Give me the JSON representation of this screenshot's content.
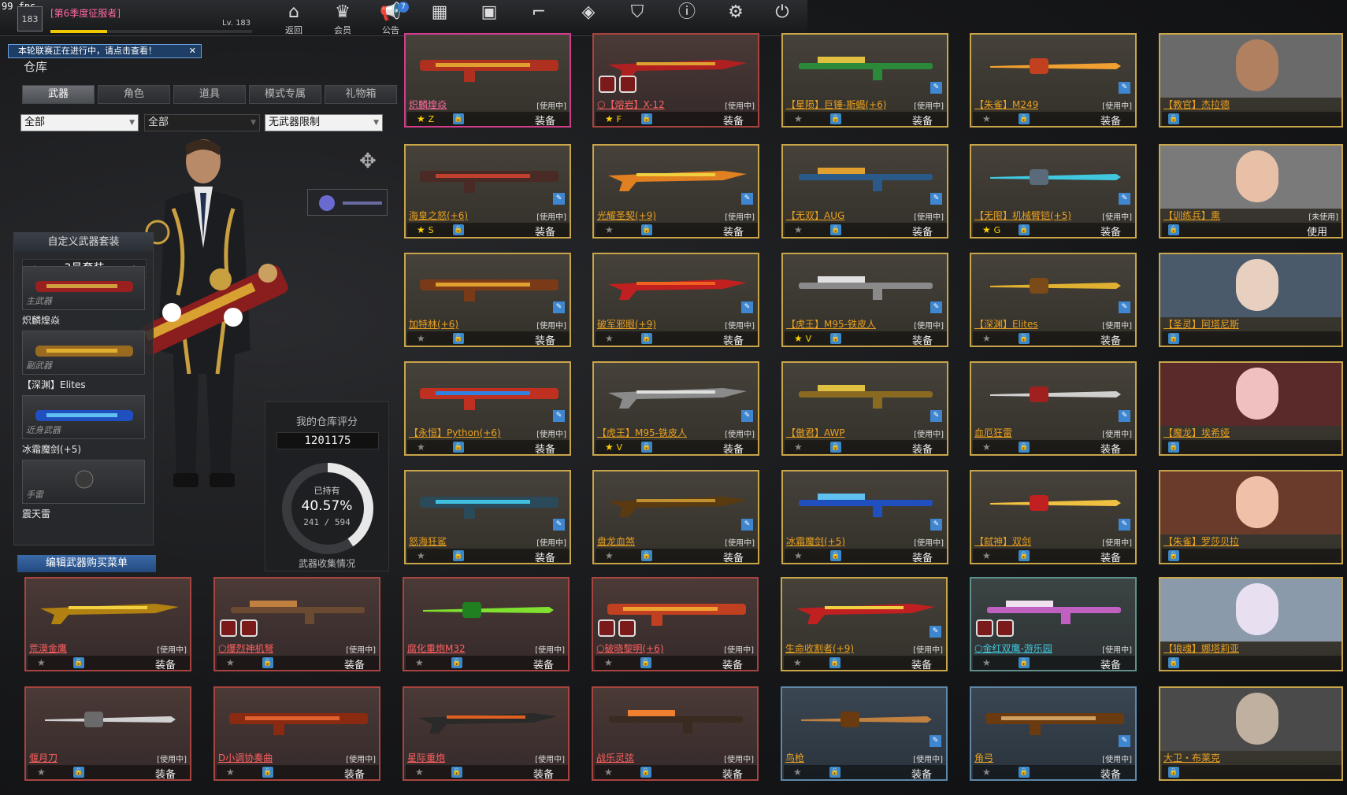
{
  "fps": "99 fps",
  "player": {
    "level_badge": "183",
    "season_title": "[第6季度征服者]",
    "level": "Lv. 183",
    "xp": 0.28
  },
  "nav": [
    {
      "label": "返回",
      "icon": "home-icon"
    },
    {
      "label": "会员",
      "icon": "crown-icon"
    },
    {
      "label": "公告",
      "icon": "megaphone-icon",
      "badge": "7"
    },
    {
      "label": "",
      "icon": "calendar-icon"
    },
    {
      "label": "",
      "icon": "briefcase-icon"
    },
    {
      "label": "",
      "icon": "boot-icon"
    },
    {
      "label": "",
      "icon": "ticket-icon"
    },
    {
      "label": "",
      "icon": "shield-f-icon"
    },
    {
      "label": "",
      "icon": "alert-icon"
    },
    {
      "label": "",
      "icon": "gear-icon"
    },
    {
      "label": "",
      "icon": "power-icon"
    }
  ],
  "notice": "本轮联赛正在进行中，请点击查看！",
  "warehouse_title": "仓库",
  "tabs": [
    "武器",
    "角色",
    "道具",
    "模式专属",
    "礼物箱"
  ],
  "filters": [
    "全部",
    "全部",
    "无武器限制"
  ],
  "loadout": {
    "header": "自定义武器套装",
    "set": "3号套装",
    "slots": [
      {
        "type": "主武器",
        "name": "炽麟煌焱",
        "color": "#e8e8e8"
      },
      {
        "type": "副武器",
        "name": "【深渊】Elites",
        "color": "#e8e8e8"
      },
      {
        "type": "近身武器",
        "name": "冰霜魔剑(+5)",
        "color": "#e8e8e8"
      },
      {
        "type": "手雷",
        "name": "震天雷",
        "color": "#e8e8e8"
      }
    ],
    "edit_buy": "编辑武器购买菜单"
  },
  "rating": {
    "title": "我的仓库评分",
    "score": "1201175",
    "owned_label": "已持有",
    "percent": "40.57%",
    "count": "241 / 594",
    "caption": "武器收集情况",
    "fraction": 0.4057
  },
  "status_in_use": "[使用中]",
  "status_unused": "[未使用]",
  "equip": "装备",
  "use": "使用",
  "weapons": [
    {
      "name": "炽麟煌焱",
      "grade": "Z",
      "style": "pink",
      "namecolor": "pink",
      "col": 0,
      "row": 0,
      "c1": "#b03020",
      "c2": "#e0a030"
    },
    {
      "name": "⬡【熔岩】X-12",
      "grade": "F",
      "style": "red",
      "namecolor": "red",
      "col": 1,
      "row": 0,
      "c1": "#b02020",
      "c2": "#e0a030",
      "mods": true
    },
    {
      "name": "【星陨】巨锤-斯蝎(+6)",
      "grade": "",
      "style": "gold",
      "namecolor": "",
      "col": 2,
      "row": 0,
      "c1": "#2a8a3a",
      "c2": "#e0c040"
    },
    {
      "name": "【朱雀】M249",
      "grade": "",
      "style": "gold",
      "namecolor": "",
      "col": 3,
      "row": 0,
      "c1": "#c04020",
      "c2": "#f0a030"
    },
    {
      "name": "海皇之怒(+6)",
      "grade": "S",
      "style": "gold",
      "namecolor": "",
      "col": 0,
      "row": 1,
      "c1": "#4a2a24",
      "c2": "#c04030"
    },
    {
      "name": "光耀圣契(+9)",
      "grade": "",
      "style": "gold",
      "namecolor": "",
      "col": 1,
      "row": 1,
      "c1": "#e08020",
      "c2": "#f0d040"
    },
    {
      "name": "【无双】AUG",
      "grade": "",
      "style": "gold",
      "namecolor": "",
      "col": 2,
      "row": 1,
      "c1": "#2a5a8a",
      "c2": "#e0a030"
    },
    {
      "name": "【无限】机械臂铠(+5)",
      "grade": "G",
      "style": "gold",
      "namecolor": "",
      "col": 3,
      "row": 1,
      "c1": "#5a6a7a",
      "c2": "#40c8e0"
    },
    {
      "name": "加特林(+6)",
      "grade": "",
      "style": "gold",
      "namecolor": "",
      "col": 0,
      "row": 2,
      "c1": "#7a3a18",
      "c2": "#e0a030"
    },
    {
      "name": "破军邪眼(+9)",
      "grade": "",
      "style": "gold",
      "namecolor": "",
      "col": 1,
      "row": 2,
      "c1": "#c02020",
      "c2": "#f06020"
    },
    {
      "name": "【虎王】M95-铁皮人",
      "grade": "V",
      "style": "gold",
      "namecolor": "",
      "col": 2,
      "row": 2,
      "c1": "#8a8a8a",
      "c2": "#e0e0e0"
    },
    {
      "name": "【深渊】Elites",
      "grade": "",
      "style": "gold",
      "namecolor": "",
      "col": 3,
      "row": 2,
      "c1": "#7a4a18",
      "c2": "#e0b030"
    },
    {
      "name": "【永恒】Python(+6)",
      "grade": "",
      "style": "gold",
      "namecolor": "",
      "col": 0,
      "row": 3,
      "c1": "#c03020",
      "c2": "#3080e0"
    },
    {
      "name": "【虎王】M95-铁皮人",
      "grade": "V",
      "style": "gold",
      "namecolor": "",
      "col": 1,
      "row": 3,
      "c1": "#8a8a8a",
      "c2": "#e0e0e0"
    },
    {
      "name": "【傲君】AWP",
      "grade": "",
      "style": "gold",
      "namecolor": "",
      "col": 2,
      "row": 3,
      "c1": "#8a6a20",
      "c2": "#e0c040"
    },
    {
      "name": "血厄狂雷",
      "grade": "",
      "style": "gold",
      "namecolor": "",
      "col": 3,
      "row": 3,
      "c1": "#a02020",
      "c2": "#d0d0d0"
    },
    {
      "name": "怒海狂鲨",
      "grade": "",
      "style": "gold",
      "namecolor": "",
      "col": 0,
      "row": 4,
      "c1": "#2a4a5a",
      "c2": "#40c0e0"
    },
    {
      "name": "盘龙血煞",
      "grade": "",
      "style": "gold",
      "namecolor": "",
      "col": 1,
      "row": 4,
      "c1": "#5a3a10",
      "c2": "#c09030"
    },
    {
      "name": "冰霜魔剑(+5)",
      "grade": "",
      "style": "gold",
      "namecolor": "",
      "col": 2,
      "row": 4,
      "c1": "#2050c0",
      "c2": "#60c0f0"
    },
    {
      "name": "【弑神】双剑",
      "grade": "",
      "style": "gold",
      "namecolor": "",
      "col": 3,
      "row": 4,
      "c1": "#c02020",
      "c2": "#f0c040"
    }
  ],
  "weapons_bottom": [
    {
      "name": "荒漠金鹰",
      "style": "red",
      "namecolor": "red",
      "x": 0,
      "row": 0,
      "c1": "#b08010",
      "c2": "#f0d040"
    },
    {
      "name": "⬡爆烈神机弩",
      "style": "red",
      "namecolor": "red",
      "x": 1,
      "row": 0,
      "c1": "#6a4a30",
      "c2": "#c08040",
      "mods": true
    },
    {
      "name": "腐化重炮M32",
      "style": "red",
      "namecolor": "red",
      "x": 2,
      "row": 0,
      "c1": "#208020",
      "c2": "#80e030"
    },
    {
      "name": "⬡破晓黎明(+6)",
      "style": "red",
      "namecolor": "red",
      "x": 3,
      "row": 0,
      "c1": "#c04020",
      "c2": "#f0a030",
      "mods": true
    },
    {
      "name": "生命收割者(+9)",
      "style": "gold",
      "namecolor": "",
      "x": 4,
      "row": 0,
      "c1": "#c02020",
      "c2": "#f0d040"
    },
    {
      "name": "⬡金红双鹰-游乐园",
      "style": "teal",
      "namecolor": "cyan",
      "x": 5,
      "row": 0,
      "c1": "#c060c0",
      "c2": "#f0e0f0",
      "mods": true
    },
    {
      "name": "偃月刀",
      "style": "red",
      "namecolor": "red",
      "x": 0,
      "row": 1,
      "c1": "#6a6a6a",
      "c2": "#d0d0d0"
    },
    {
      "name": "D小调协奏曲",
      "style": "red",
      "namecolor": "red",
      "x": 1,
      "row": 1,
      "c1": "#8a2a10",
      "c2": "#e06030"
    },
    {
      "name": "星际重炮",
      "style": "red",
      "namecolor": "red",
      "x": 2,
      "row": 1,
      "c1": "#2a2a2a",
      "c2": "#e06020"
    },
    {
      "name": "战乐灵弦",
      "style": "red",
      "namecolor": "red",
      "x": 3,
      "row": 1,
      "c1": "#3a2a20",
      "c2": "#f08030"
    },
    {
      "name": "鸟枪",
      "style": "blue",
      "namecolor": "",
      "x": 4,
      "row": 1,
      "c1": "#6a3a10",
      "c2": "#c08040"
    },
    {
      "name": "角弓",
      "style": "blue",
      "namecolor": "",
      "x": 5,
      "row": 1,
      "c1": "#6a3a10",
      "c2": "#d0a060"
    }
  ],
  "characters": [
    {
      "name": "【教官】杰拉德",
      "status": "",
      "button": "",
      "skin": "#b08060",
      "bg": "#6a6a6a"
    },
    {
      "name": "【训练兵】熏",
      "status": "[未使用]",
      "button": "使用",
      "skin": "#e8c0a8",
      "bg": "#7a7a7a"
    },
    {
      "name": "【圣灵】阿塔尼斯",
      "status": "",
      "button": "",
      "skin": "#e8d0c0",
      "bg": "#4a5a6a"
    },
    {
      "name": "【魔龙】埃希娅",
      "status": "",
      "button": "",
      "skin": "#f0c0c0",
      "bg": "#5a2a2a"
    },
    {
      "name": "【朱雀】罗莎贝拉",
      "status": "",
      "button": "",
      "skin": "#f0c0a8",
      "bg": "#6a3a2a"
    },
    {
      "name": "【狼魂】娜塔莉亚",
      "status": "",
      "button": "",
      "skin": "#e8e0f0",
      "bg": "#8a9aaa"
    },
    {
      "name": "大卫・布莱克",
      "status": "",
      "button": "",
      "skin": "#c0b0a0",
      "bg": "#4a4a4a"
    }
  ]
}
